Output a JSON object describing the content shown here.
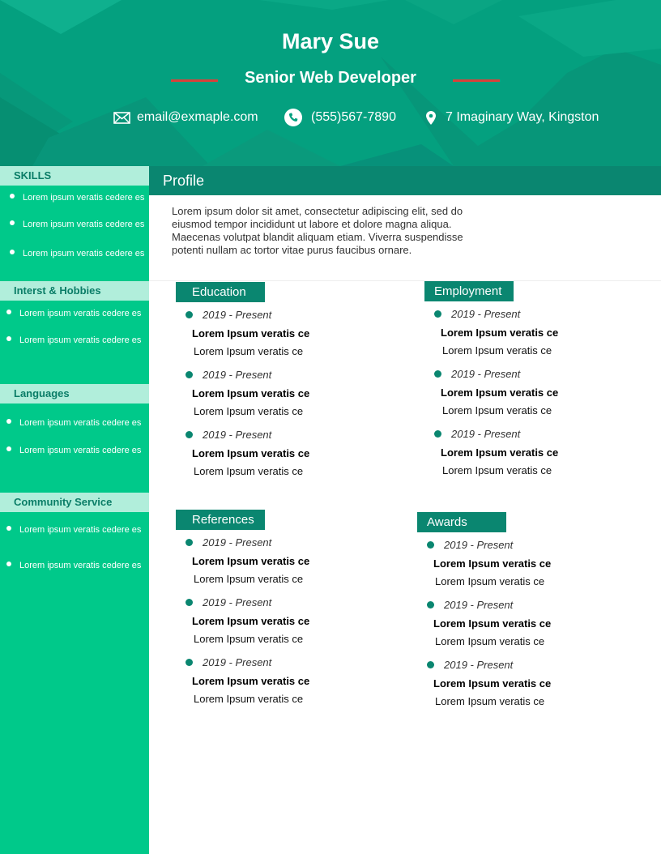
{
  "header": {
    "name": "Mary Sue",
    "title": "Senior Web Developer",
    "accent_color": "#d9413a",
    "contacts": [
      {
        "icon": "envelope-icon",
        "text": "email@exmaple.com"
      },
      {
        "icon": "phone-icon",
        "text": "(555)567-7890"
      },
      {
        "icon": "location-pin-icon",
        "text": "7 Imaginary Way, Kingston"
      }
    ]
  },
  "sidebar": {
    "sections": [
      {
        "title": "SKILLS",
        "items": [
          "Lorem ipsum veratis cedere es",
          "Lorem ipsum veratis cedere es",
          "Lorem ipsum veratis cedere es"
        ]
      },
      {
        "title": "Interst & Hobbies",
        "items": [
          "Lorem ipsum veratis cedere es",
          "Lorem ipsum veratis cedere es"
        ]
      },
      {
        "title": "Languages",
        "items": [
          "Lorem ipsum veratis cedere es",
          "Lorem ipsum veratis cedere es"
        ]
      },
      {
        "title": "Community Service",
        "items": [
          "Lorem ipsum veratis cedere es",
          "Lorem ipsum veratis cedere es"
        ]
      }
    ]
  },
  "profile": {
    "title": "Profile",
    "text": "Lorem ipsum dolor sit amet, consectetur adipiscing elit, sed do eiusmod tempor incididunt ut labore et dolore magna aliqua. Maecenas volutpat blandit aliquam etiam. Viverra suspendisse potenti nullam ac tortor vitae purus faucibus ornare."
  },
  "sections": [
    {
      "key": "education",
      "title": "Education",
      "entries": [
        {
          "date": "2019 - Present",
          "title": "Lorem Ipsum veratis ce",
          "sub": "Lorem Ipsum veratis ce"
        },
        {
          "date": "2019 - Present",
          "title": "Lorem Ipsum veratis ce",
          "sub": "Lorem Ipsum veratis ce"
        },
        {
          "date": "2019 - Present",
          "title": "Lorem Ipsum veratis ce",
          "sub": "Lorem Ipsum veratis ce"
        }
      ]
    },
    {
      "key": "employment",
      "title": "Employment",
      "entries": [
        {
          "date": "2019 - Present",
          "title": "Lorem Ipsum veratis ce",
          "sub": "Lorem Ipsum veratis ce"
        },
        {
          "date": "2019 - Present",
          "title": "Lorem Ipsum veratis ce",
          "sub": "Lorem Ipsum veratis ce"
        },
        {
          "date": "2019 - Present",
          "title": "Lorem Ipsum veratis ce",
          "sub": "Lorem Ipsum veratis ce"
        }
      ]
    },
    {
      "key": "references",
      "title": "References",
      "entries": [
        {
          "date": "2019 - Present",
          "title": "Lorem Ipsum veratis ce",
          "sub": "Lorem Ipsum veratis ce"
        },
        {
          "date": "2019 - Present",
          "title": "Lorem Ipsum veratis ce",
          "sub": "Lorem Ipsum veratis ce"
        },
        {
          "date": "2019 - Present",
          "title": "Lorem Ipsum veratis ce",
          "sub": "Lorem Ipsum veratis ce"
        }
      ]
    },
    {
      "key": "awards",
      "title": "Awards",
      "entries": [
        {
          "date": "2019 - Present",
          "title": "Lorem Ipsum veratis ce",
          "sub": "Lorem Ipsum veratis ce"
        },
        {
          "date": "2019 - Present",
          "title": "Lorem Ipsum veratis ce",
          "sub": "Lorem Ipsum veratis ce"
        },
        {
          "date": "2019 - Present",
          "title": "Lorem Ipsum veratis ce",
          "sub": "Lorem Ipsum veratis ce"
        }
      ]
    }
  ],
  "colors": {
    "header_bg": "#04a07f",
    "sidebar_bg": "#00c98a",
    "sidebar_heading_bg": "#b1eedb",
    "section_heading_bg": "#0a8670"
  }
}
